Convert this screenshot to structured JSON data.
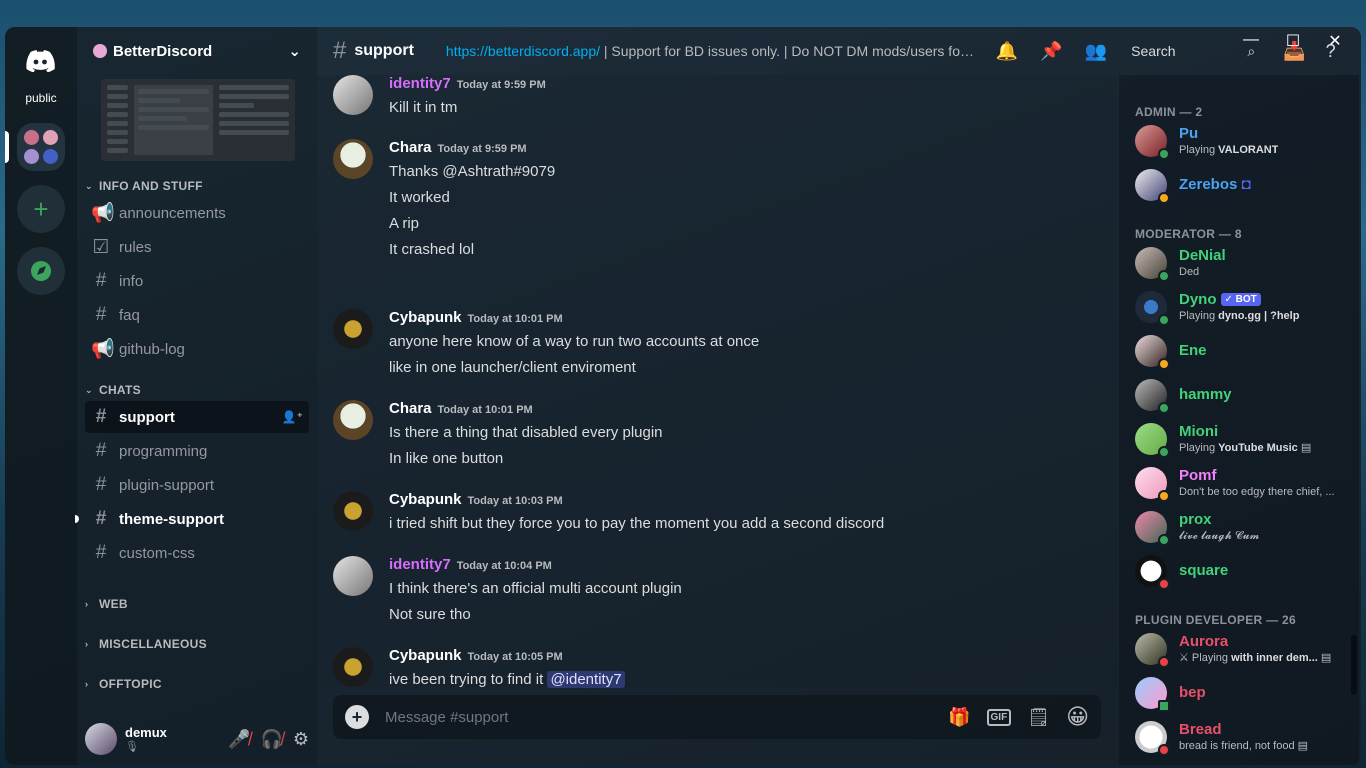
{
  "window": {
    "min": "—",
    "max": "☐",
    "close": "✕"
  },
  "guilds": {
    "public_label": "public"
  },
  "server": {
    "name": "BetterDiscord",
    "categories": {
      "info": "INFO AND STUFF",
      "chats": "CHATS",
      "web": "WEB",
      "misc": "MISCELLANEOUS",
      "offtopic": "OFFTOPIC"
    },
    "info_channels": [
      {
        "name": "announcements",
        "icon": "megaphone-icon"
      },
      {
        "name": "rules",
        "icon": "rules-check-icon"
      },
      {
        "name": "info",
        "icon": "hash-icon"
      },
      {
        "name": "faq",
        "icon": "hash-icon"
      },
      {
        "name": "github-log",
        "icon": "megaphone-icon"
      }
    ],
    "chat_channels": [
      {
        "name": "support",
        "state": "active"
      },
      {
        "name": "programming",
        "state": "normal"
      },
      {
        "name": "plugin-support",
        "state": "normal"
      },
      {
        "name": "theme-support",
        "state": "unread"
      },
      {
        "name": "custom-css",
        "state": "normal"
      }
    ]
  },
  "user": {
    "name": "demux"
  },
  "header": {
    "channel": "support",
    "topic_link": "https://betterdiscord.app/",
    "topic_rest": " | Support for BD issues only. | Do NOT DM mods/users for s...",
    "search_placeholder": "Search"
  },
  "messages": [
    {
      "author": "identity7",
      "color": "#d66efd",
      "time": "Today at 9:59 PM",
      "lines": [
        "Kill it in tm"
      ]
    },
    {
      "author": "Chara",
      "color": "#ffffff",
      "time": "Today at 9:59 PM",
      "lines": [
        "Thanks @Ashtrath#9079",
        "It worked",
        "A rip",
        "It crashed lol"
      ]
    },
    {
      "author": "Cybapunk",
      "color": "#ffffff",
      "time": "Today at 10:01 PM",
      "lines": [
        "anyone here know of a way to run two accounts at once",
        "like in one launcher/client enviroment"
      ]
    },
    {
      "author": "Chara",
      "color": "#ffffff",
      "time": "Today at 10:01 PM",
      "lines": [
        "Is there a thing that disabled every plugin",
        "In like one button"
      ]
    },
    {
      "author": "Cybapunk",
      "color": "#ffffff",
      "time": "Today at 10:03 PM",
      "lines": [
        "i tried shift but they force you to pay the moment you add a second discord"
      ]
    },
    {
      "author": "identity7",
      "color": "#d66efd",
      "time": "Today at 10:04 PM",
      "lines": [
        "I think there's an official multi account plugin",
        "Not sure tho"
      ]
    },
    {
      "author": "Cybapunk",
      "color": "#ffffff",
      "time": "Today at 10:05 PM",
      "lines": [
        "ive been trying to find it"
      ],
      "mention": "@identity7"
    }
  ],
  "composer": {
    "placeholder": "Message #support",
    "gif": "GIF"
  },
  "members": {
    "roles": [
      {
        "title": "ADMIN — 2"
      },
      {
        "title": "MODERATOR — 8"
      },
      {
        "title": "PLUGIN DEVELOPER — 26"
      }
    ],
    "admin": [
      {
        "name": "Pu",
        "color": "#4aa3f0",
        "activity_pre": "Playing ",
        "activity_bold": "VALORANT",
        "status": "online"
      },
      {
        "name": "Zerebos",
        "color": "#4aa3f0",
        "status": "idle"
      }
    ],
    "moderator": [
      {
        "name": "DeNial",
        "color": "#43d17a",
        "activity_pre": "Ded",
        "status": "online"
      },
      {
        "name": "Dyno",
        "color": "#43d17a",
        "bot": "✓ BOT",
        "activity_pre": "Playing ",
        "activity_bold": "dyno.gg | ?help",
        "status": "online"
      },
      {
        "name": "Ene",
        "color": "#43d17a",
        "status": "idle"
      },
      {
        "name": "hammy",
        "color": "#43d17a",
        "status": "online"
      },
      {
        "name": "Mioni",
        "color": "#43d17a",
        "activity_pre": "Playing ",
        "activity_bold": "YouTube Music",
        "status": "online"
      },
      {
        "name": "Pomf",
        "color": "#f47fff",
        "activity_pre": "Don't be too edgy there chief, ...",
        "status": "idle"
      },
      {
        "name": "prox",
        "color": "#43d17a",
        "activity_pre": "𝓵𝓲𝓿𝓮 𝓵𝓪𝓾𝓰𝓱 𝓒𝓾𝓶",
        "status": "online"
      },
      {
        "name": "square",
        "color": "#43d17a",
        "status": "dnd"
      }
    ],
    "plugin_dev": [
      {
        "name": "Aurora",
        "color": "#e8506a",
        "activity_pre": "⚔ Playing ",
        "activity_bold": "with inner dem...",
        "status": "dnd"
      },
      {
        "name": "bep",
        "color": "#e8506a",
        "status": "online"
      },
      {
        "name": "Bread",
        "color": "#e8506a",
        "activity_pre": "bread is friend, not food",
        "status": "dnd"
      }
    ]
  }
}
